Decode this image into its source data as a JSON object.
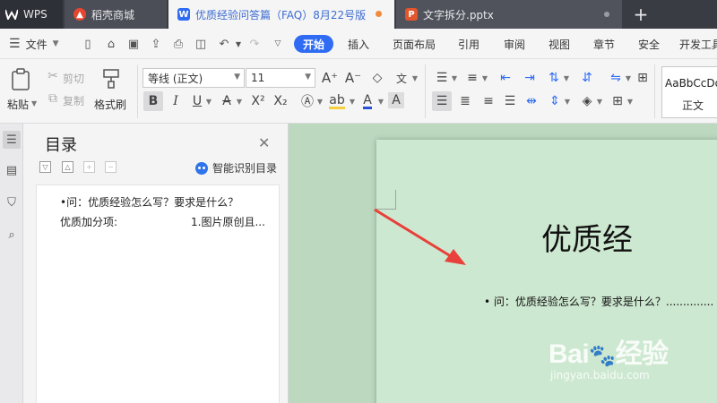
{
  "tabs": {
    "wps": "WPS",
    "store": "稻壳商城",
    "doc": "优质经验问答篇（FAQ）8月22号版",
    "ppt": "文字拆分.pptx",
    "add": "+"
  },
  "menu": {
    "file": "文件",
    "tabs": [
      "开始",
      "插入",
      "页面布局",
      "引用",
      "审阅",
      "视图",
      "章节",
      "安全",
      "开发工具"
    ]
  },
  "ribbon": {
    "paste": "粘贴",
    "cut": "剪切",
    "copy": "复制",
    "format_painter": "格式刷",
    "font_name": "等线 (正文)",
    "font_size": "11",
    "style_preview": "AaBbCcDd",
    "style_name": "正文"
  },
  "toc": {
    "title": "目录",
    "smart_label": "智能识别目录",
    "items": [
      "•问：优质经验怎么写？要求是什么？",
      "优质加分项:",
      "1.图片原创且..."
    ]
  },
  "document": {
    "title": "优质经",
    "line": "• 问：优质经验怎么写？要求是什么？.............."
  },
  "watermark": {
    "logo": "Bai 经验",
    "url": "jingyan.baidu.com"
  },
  "colors": {
    "accent": "#2f6cf3",
    "tab_dot": "#f08a3c",
    "arrow": "#e8403a",
    "canvas": "#bcd9bf",
    "page": "#cde8d0"
  }
}
